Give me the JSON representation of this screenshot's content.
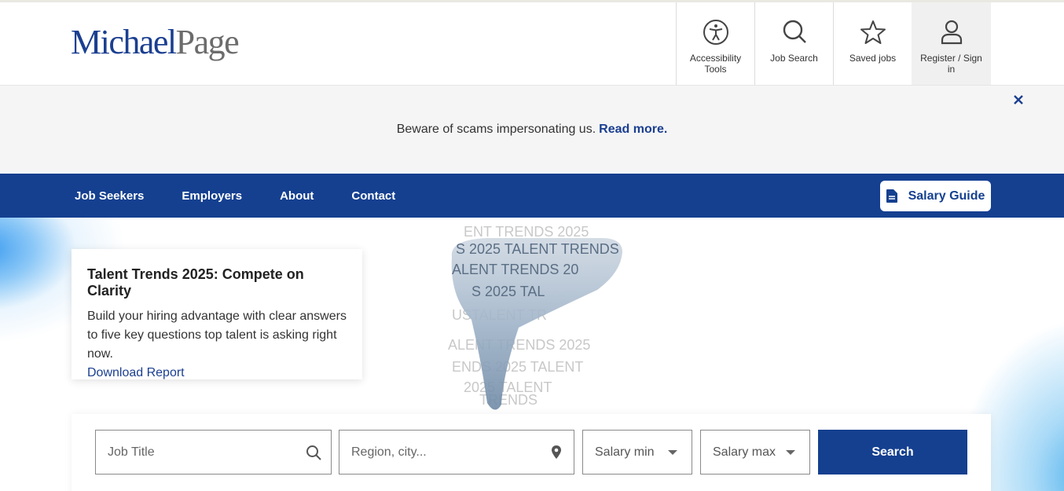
{
  "brand": {
    "logo_part1": "Michael",
    "logo_part2": "Page"
  },
  "utility_nav": [
    {
      "label": "Accessibility Tools",
      "icon": "accessibility-icon"
    },
    {
      "label": "Job Search",
      "icon": "search-icon"
    },
    {
      "label": "Saved jobs",
      "icon": "star-icon"
    },
    {
      "label": "Register / Sign in",
      "icon": "user-icon"
    }
  ],
  "banner": {
    "message": "Beware of scams impersonating us.",
    "link": "Read more.",
    "close_icon": "close-icon"
  },
  "main_nav": [
    "Job Seekers",
    "Employers",
    "About",
    "Contact"
  ],
  "salary_guide": {
    "label": "Salary Guide",
    "icon": "document-icon"
  },
  "hero_card": {
    "title": "Talent Trends 2025: Compete on Clarity",
    "body": "Build your hiring advantage with clear answers to five key questions top talent is asking right now.",
    "link": "Download Report"
  },
  "hero_art": {
    "text_line": "TALENT TRENDS 2025"
  },
  "search": {
    "job_title_placeholder": "Job Title",
    "location_placeholder": "Region, city...",
    "salary_min": "Salary min",
    "salary_max": "Salary max",
    "button": "Search"
  },
  "colors": {
    "brand_blue": "#154090",
    "logo_grey": "#6c6c6c",
    "banner_bg": "#f5f5f5"
  }
}
